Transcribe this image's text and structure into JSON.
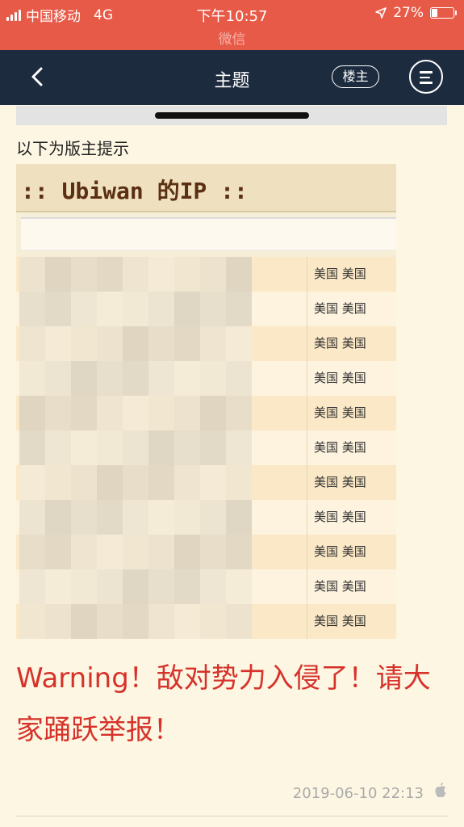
{
  "status_bar": {
    "carrier": "中国移动",
    "network": "4G",
    "time": "下午10:57",
    "battery_pct": "27%",
    "battery_level": 0.27,
    "return_app": "微信"
  },
  "nav": {
    "title": "主题",
    "owner_button": "楼主"
  },
  "post": {
    "moderator_notice": "以下为版主提示",
    "ip_table": {
      "title": ":: Ubiwan 的IP ::",
      "rows": [
        {
          "country": "美国 美国"
        },
        {
          "country": "美国 美国"
        },
        {
          "country": "美国 美国"
        },
        {
          "country": "美国 美国"
        },
        {
          "country": "美国 美国"
        },
        {
          "country": "美国 美国"
        },
        {
          "country": "美国 美国"
        },
        {
          "country": "美国 美国"
        },
        {
          "country": "美国 美国"
        },
        {
          "country": "美国 美国"
        },
        {
          "country": "美国 美国"
        }
      ]
    },
    "warning_text": "Warning！敌对势力入侵了！请大家踊跃举报！",
    "timestamp": "2019-06-10 22:13"
  },
  "colors": {
    "status_bar_bg": "#e85a48",
    "nav_bg": "#1d2b3f",
    "page_bg": "#fdf6e3",
    "warning": "#d6322a"
  },
  "icons": {
    "back": "chevron-left-icon",
    "menu": "menu-circle-icon",
    "device": "apple-icon",
    "location": "location-arrow-icon"
  }
}
